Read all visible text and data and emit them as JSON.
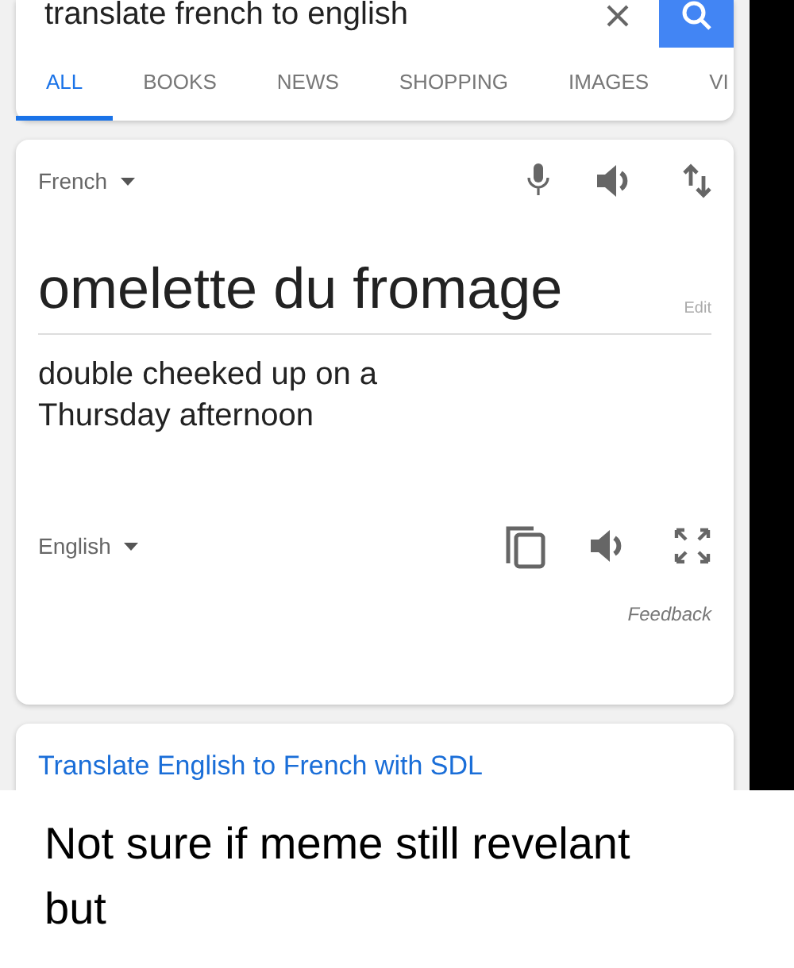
{
  "search": {
    "query": "translate french to english"
  },
  "tabs": [
    {
      "label": "ALL",
      "selected": true
    },
    {
      "label": "BOOKS",
      "selected": false
    },
    {
      "label": "NEWS",
      "selected": false
    },
    {
      "label": "SHOPPING",
      "selected": false
    },
    {
      "label": "IMAGES",
      "selected": false
    },
    {
      "label": "VI",
      "selected": false
    }
  ],
  "translator": {
    "source_language": "French",
    "source_text": "omelette du fromage",
    "edit_label": "Edit",
    "target_text": "double cheeked up on a Thursday afternoon",
    "target_language": "English",
    "feedback": "Feedback"
  },
  "result": {
    "title": "Translate English to French with SDL"
  },
  "caption": "Not sure if meme still revelant but"
}
